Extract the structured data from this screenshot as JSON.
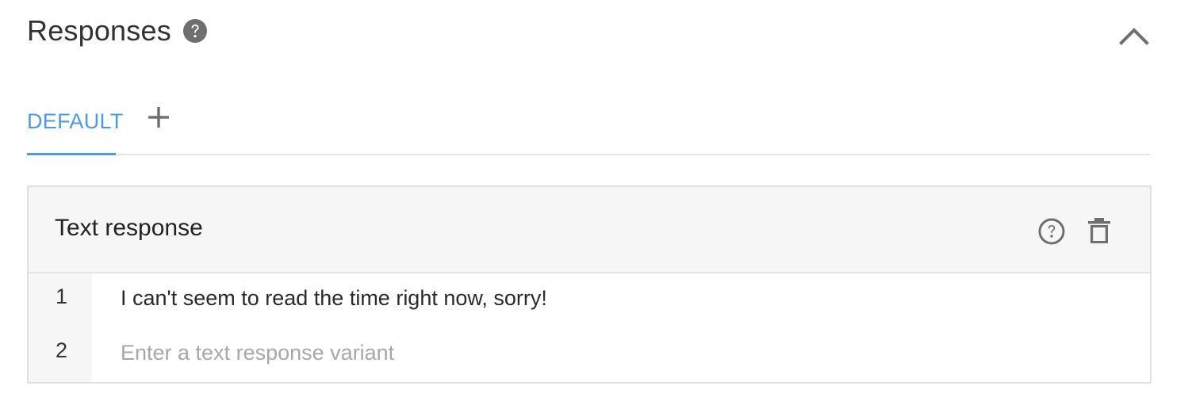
{
  "section": {
    "title": "Responses"
  },
  "tabs": [
    {
      "label": "DEFAULT",
      "active": true
    }
  ],
  "card": {
    "title": "Text response",
    "rows": [
      {
        "number": "1",
        "text": "I can't seem to read the time right now, sorry!"
      },
      {
        "number": "2",
        "placeholder": "Enter a text response variant"
      }
    ]
  },
  "colors": {
    "accent": "#4a9be0",
    "icon": "#6f6f6f",
    "title": "#2f3338"
  },
  "icons": {
    "section_help": "help-filled-icon",
    "collapse": "chevron-up-icon",
    "add_tab": "plus-icon",
    "card_help": "help-outline-icon",
    "card_delete": "trash-icon"
  }
}
